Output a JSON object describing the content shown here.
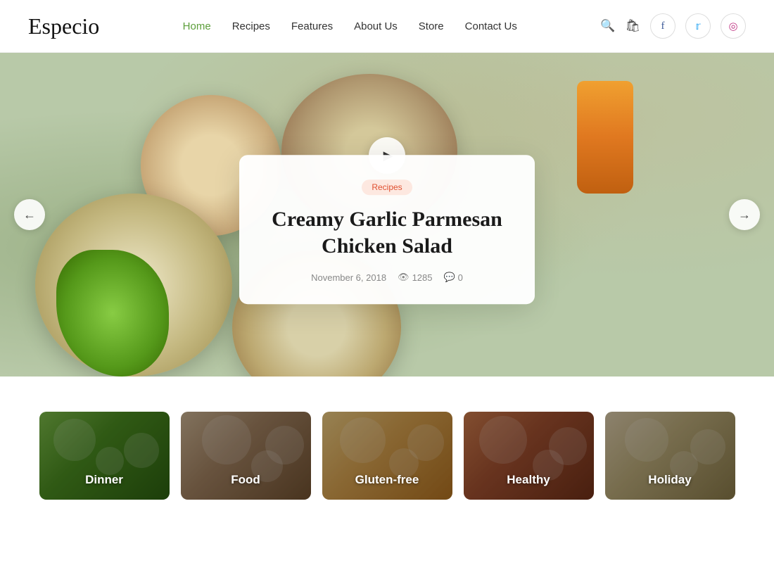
{
  "brand": {
    "name": "Especio"
  },
  "nav": {
    "items": [
      {
        "label": "Home",
        "active": true
      },
      {
        "label": "Recipes",
        "active": false
      },
      {
        "label": "Features",
        "active": false
      },
      {
        "label": "About Us",
        "active": false
      },
      {
        "label": "Store",
        "active": false
      },
      {
        "label": "Contact Us",
        "active": false
      }
    ]
  },
  "social": {
    "facebook": "f",
    "twitter": "t",
    "instagram": "ig"
  },
  "hero": {
    "play_label": "▶",
    "arrow_left": "←",
    "arrow_right": "→",
    "slide": {
      "category": "Recipes",
      "title": "Creamy Garlic Parmesan Chicken Salad",
      "date": "November 6, 2018",
      "views": "1285",
      "comments": "0"
    }
  },
  "categories": {
    "items": [
      {
        "label": "Dinner"
      },
      {
        "label": "Food"
      },
      {
        "label": "Gluten-free"
      },
      {
        "label": "Healthy"
      },
      {
        "label": "Holiday"
      }
    ]
  }
}
